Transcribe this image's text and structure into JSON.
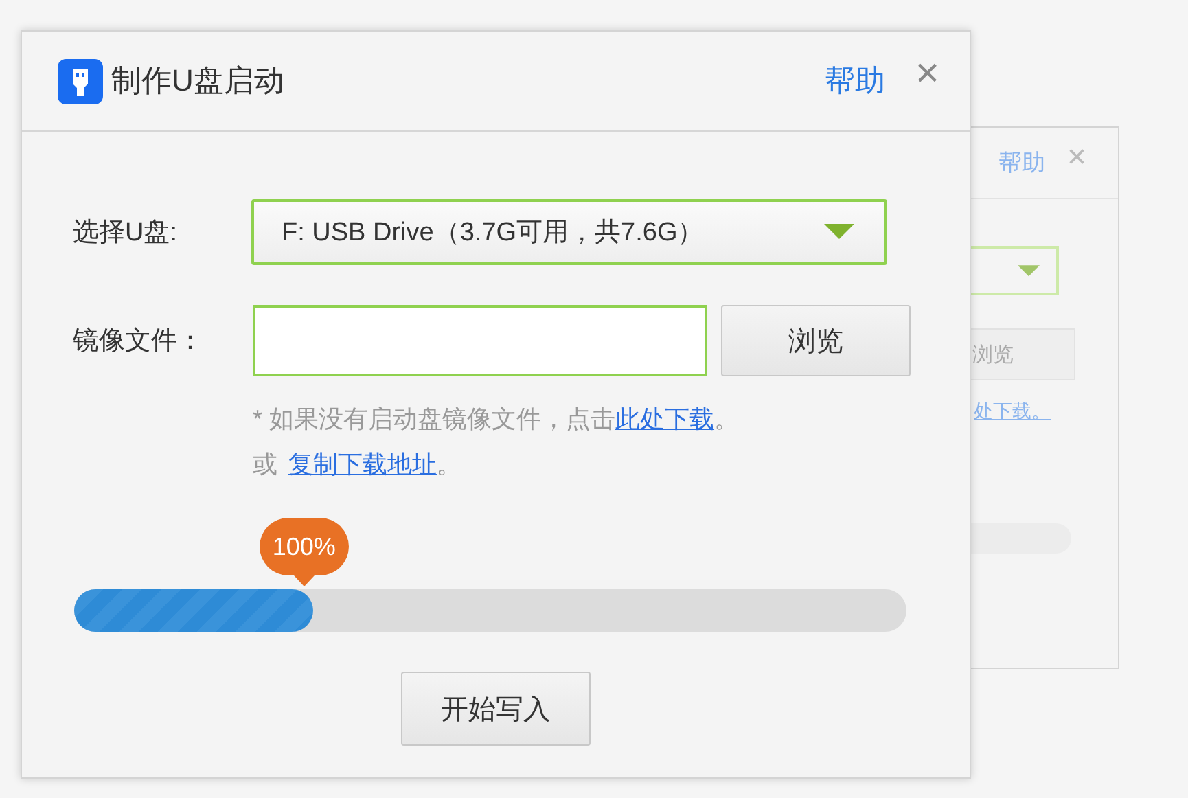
{
  "back_window": {
    "help_link": "帮助",
    "close": "×",
    "browse_button": "浏览",
    "download_link": "处下载。"
  },
  "window": {
    "title": "制作U盘启动",
    "help_link": "帮助",
    "close": "×"
  },
  "drive": {
    "label": "选择U盘:",
    "value": "F: USB Drive（3.7G可用，共7.6G）"
  },
  "image_file": {
    "label": "镜像文件：",
    "browse_button": "浏览"
  },
  "hint": {
    "text": "* 如果没有启动盘镜像文件，点击",
    "link": "此处下载",
    "end": "。",
    "or": "或",
    "copy_link": "复制下载地址",
    "end2": "。"
  },
  "progress": {
    "reading": "100%",
    "level": 0.287
  },
  "start_button": "开始写入"
}
